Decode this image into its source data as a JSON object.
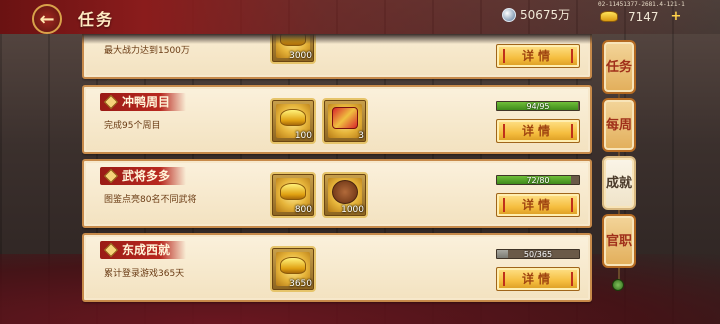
{
  "header": {
    "title": "任务",
    "back_label": "←",
    "silver": "50675万",
    "gold": "7147",
    "plus": "+",
    "device_id": "02-11451377-2681.4-121-1"
  },
  "tasks": [
    {
      "title": "",
      "desc": "最大战力达到1500万",
      "rewards": [
        {
          "count": "3000",
          "icon": "gold-ingot-icon",
          "kind": "ingot"
        }
      ],
      "progress_text": "",
      "progress": null,
      "detail_label": "详情"
    },
    {
      "title": "冲鸭周目",
      "desc": "完成95个周目",
      "rewards": [
        {
          "count": "100",
          "icon": "gold-ingot-icon",
          "kind": "ingot"
        },
        {
          "count": "3",
          "icon": "gift-box-icon",
          "kind": "box"
        }
      ],
      "progress_text": "94/95",
      "progress": 0.989,
      "detail_label": "详情"
    },
    {
      "title": "武将多多",
      "desc": "图鉴点亮80名不同武将",
      "rewards": [
        {
          "count": "800",
          "icon": "gold-ingot-icon",
          "kind": "ingot"
        },
        {
          "count": "1000",
          "icon": "food-dish-icon",
          "kind": "dish"
        }
      ],
      "progress_text": "72/80",
      "progress": 0.9,
      "detail_label": "详情"
    },
    {
      "title": "东成西就",
      "desc": "累计登录游戏365天",
      "rewards": [
        {
          "count": "3650",
          "icon": "gold-ingot-icon",
          "kind": "ingot"
        }
      ],
      "progress_text": "50/365",
      "progress": 0.137,
      "detail_label": "详情"
    }
  ],
  "side_tabs": [
    {
      "label": "任务",
      "active": false
    },
    {
      "label": "每周",
      "active": false
    },
    {
      "label": "成就",
      "active": true
    },
    {
      "label": "官职",
      "active": false
    }
  ],
  "colors": {
    "progress_fill": "#4f9a22",
    "ribbon": "#b8281f",
    "button": "#f5bd3e"
  }
}
